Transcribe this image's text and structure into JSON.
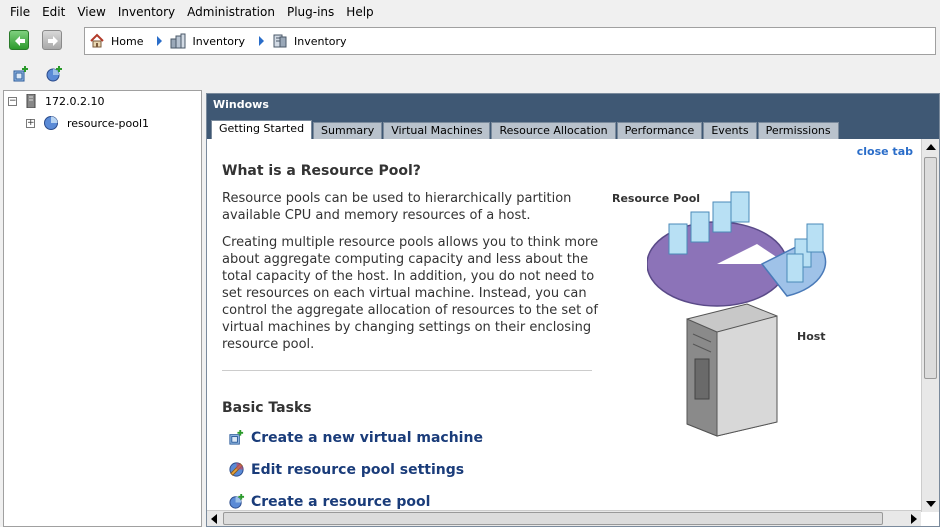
{
  "menu": [
    "File",
    "Edit",
    "View",
    "Inventory",
    "Administration",
    "Plug-ins",
    "Help"
  ],
  "breadcrumb": {
    "home": "Home",
    "item1": "Inventory",
    "item2": "Inventory"
  },
  "tree": {
    "host": "172.0.2.10",
    "pool": "resource-pool1"
  },
  "panel": {
    "title": "Windows",
    "tabs": [
      "Getting Started",
      "Summary",
      "Virtual Machines",
      "Resource Allocation",
      "Performance",
      "Events",
      "Permissions"
    ],
    "active_tab": "Getting Started"
  },
  "content": {
    "close_tab": "close tab",
    "heading": "What is a Resource Pool?",
    "para1": "Resource pools can be used to hierarchically partition available CPU and memory resources of a host.",
    "para2": "Creating multiple resource pools allows you to think more about aggregate computing capacity and less about the total capacity of the host. In addition, you do not need to set resources on each virtual machine. Instead, you can control the aggregate allocation of resources to the set of virtual machines by changing settings on their enclosing resource pool.",
    "basic_tasks": "Basic Tasks",
    "tasks": [
      "Create a new virtual machine",
      "Edit resource pool settings",
      "Create a resource pool"
    ],
    "diagram_labels": {
      "resource_pool": "Resource Pool",
      "host": "Host"
    }
  },
  "colors": {
    "panel_header": "#3f5874",
    "link": "#1a3c7a",
    "pie_purple": "#8c73b8",
    "pie_blue": "#9fc2e8"
  }
}
